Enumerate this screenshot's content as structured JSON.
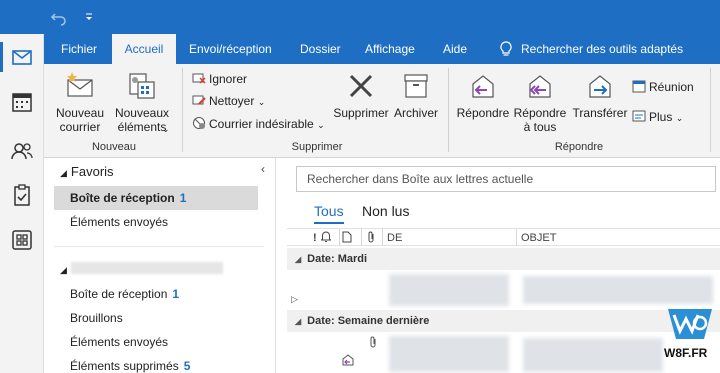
{
  "tabs": [
    {
      "label": "Fichier"
    },
    {
      "label": "Accueil"
    },
    {
      "label": "Envoi/réception"
    },
    {
      "label": "Dossier"
    },
    {
      "label": "Affichage"
    },
    {
      "label": "Aide"
    }
  ],
  "tell_me": {
    "label": "Rechercher des outils adaptés",
    "icon": "lightbulb-icon"
  },
  "ribbon": {
    "new_mail": "Nouveau courrier",
    "new_items": "Nouveaux éléments",
    "group_new": "Nouveau",
    "ignore": "Ignorer",
    "clean_up": "Nettoyer",
    "junk": "Courrier indésirable",
    "delete": "Supprimer",
    "archive": "Archiver",
    "group_delete": "Supprimer",
    "reply": "Répondre",
    "reply_all": "Répondre à tous",
    "forward": "Transférer",
    "meeting": "Réunion",
    "more": "Plus",
    "group_respond": "Répondre"
  },
  "folders": {
    "favorites_title": "Favoris",
    "favorites": [
      {
        "label": "Boîte de réception",
        "count": "1"
      },
      {
        "label": "Éléments envoyés",
        "count": ""
      }
    ],
    "account": [
      {
        "label": "Boîte de réception",
        "count": "1"
      },
      {
        "label": "Brouillons",
        "count": ""
      },
      {
        "label": "Éléments envoyés",
        "count": ""
      },
      {
        "label": "Éléments supprimés",
        "count": "5"
      }
    ]
  },
  "message_list": {
    "search_placeholder": "Rechercher dans Boîte aux lettres actuelle",
    "tab_all": "Tous",
    "tab_unread": "Non lus",
    "col_from": "DE",
    "col_subject": "OBJET",
    "group1": "Date: Mardi",
    "group2": "Date: Semaine dernière"
  },
  "watermark": {
    "text": "W8F.FR"
  },
  "colors": {
    "accent": "#1e6fc3",
    "ribbon_bg": "#f3f3f3",
    "selected_bg": "#dadada"
  }
}
